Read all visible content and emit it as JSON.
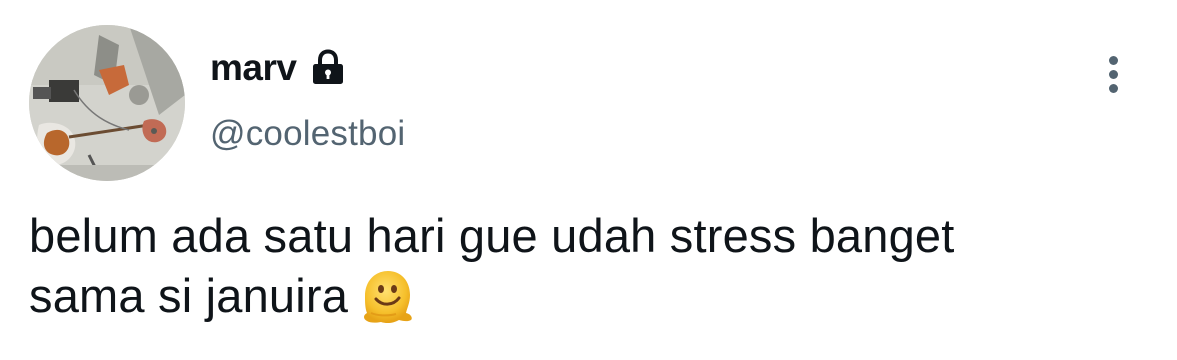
{
  "user": {
    "display_name": "marv",
    "handle": "@coolestboi",
    "protected_icon": "lock-icon",
    "avatar": "guitar-room-photo"
  },
  "menu": {
    "icon": "more-vertical-icon"
  },
  "tweet": {
    "line1": "belum ada satu hari gue udah stress banget",
    "line2": "sama si januira",
    "emoji": "melting-face-emoji"
  },
  "colors": {
    "text_primary": "#0f1419",
    "text_secondary": "#536471",
    "background": "#ffffff"
  }
}
